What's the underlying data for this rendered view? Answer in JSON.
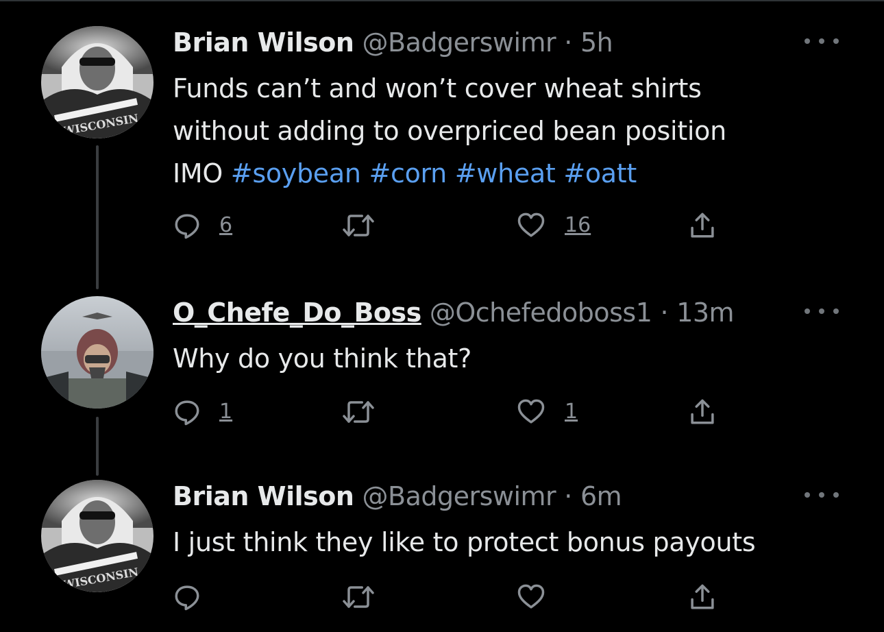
{
  "thread": [
    {
      "author": {
        "name": "Brian Wilson",
        "handle": "@Badgerswimr",
        "separator": "·",
        "time": "5h",
        "avatar_text": "WISCONSIN"
      },
      "text_lines": [
        "Funds can’t and won’t cover wheat shirts",
        "without adding to overpriced bean position"
      ],
      "last_line_prefix": "IMO ",
      "hashtags": [
        "#soybean",
        "#corn",
        "#wheat",
        "#oatt"
      ],
      "stats": {
        "replies": "6",
        "likes": "16"
      }
    },
    {
      "author": {
        "name": "O_Chefe_Do_Boss",
        "handle": "@Ochefedoboss1",
        "separator": "·",
        "time": "13m"
      },
      "text": "Why do you think that?",
      "stats": {
        "replies": "1",
        "likes": "1"
      }
    },
    {
      "author": {
        "name": "Brian Wilson",
        "handle": "@Badgerswimr",
        "separator": "·",
        "time": "6m",
        "avatar_text": "WISCONSIN"
      },
      "text": "I just think they like to protect bonus payouts",
      "stats": {
        "replies": "",
        "likes": ""
      }
    }
  ],
  "colors": {
    "background": "#000000",
    "text": "#e7e9ea",
    "muted": "#8b9096",
    "hashtag": "#5a9ff0",
    "thread_line": "#3a3d40"
  },
  "icons": [
    "reply-icon",
    "retweet-icon",
    "like-icon",
    "share-icon",
    "more-icon"
  ]
}
